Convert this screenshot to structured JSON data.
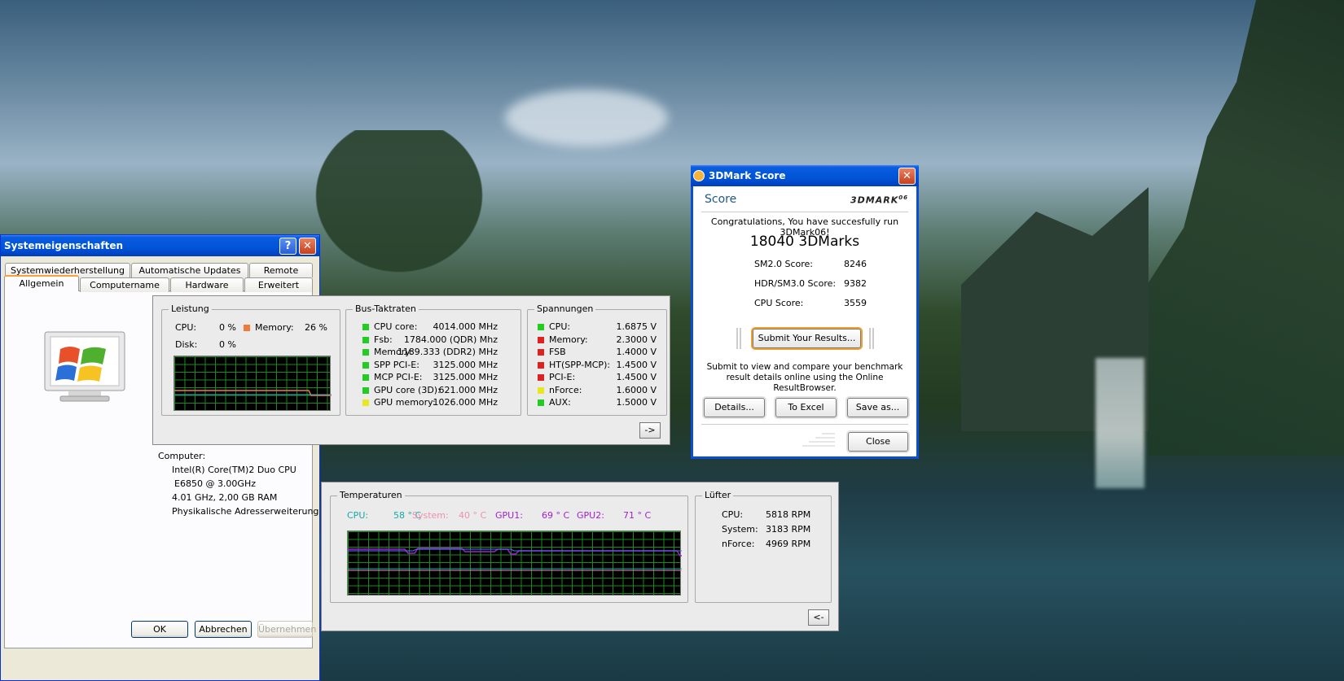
{
  "desktop": {
    "wallpaper": "tropical-island"
  },
  "sysprops": {
    "title": "Systemeigenschaften",
    "tabs_row1": [
      "Systemwiederherstellung",
      "Automatische Updates",
      "Remote"
    ],
    "tabs_row2": [
      "Allgemein",
      "Computername",
      "Hardware",
      "Erweitert"
    ],
    "computer_label": "Computer:",
    "computer_lines": [
      "Intel(R) Core(TM)2 Duo CPU",
      "E6850  @ 3.00GHz",
      "4.01 GHz, 2,00 GB RAM",
      "Physikalische Adresserweiterung"
    ],
    "buttons": {
      "ok": "OK",
      "cancel": "Abbrechen",
      "apply": "Übernehmen"
    }
  },
  "monitor_top": {
    "leistung": {
      "title": "Leistung",
      "cpu_label": "CPU:",
      "cpu_value": "0 %",
      "memory_label": "Memory:",
      "memory_value": "26 %",
      "disk_label": "Disk:",
      "disk_value": "0 %"
    },
    "bus": {
      "title": "Bus-Taktraten",
      "rows": [
        {
          "label": "CPU core:",
          "value": "4014.000 MHz",
          "color": "#22cc22"
        },
        {
          "label": "Fsb:",
          "value": "1784.000 (QDR) Mhz",
          "color": "#22cc22"
        },
        {
          "label": "Memory:",
          "value": "1189.333 (DDR2) MHz",
          "color": "#22cc22"
        },
        {
          "label": "SPP PCI-E:",
          "value": "3125.000 MHz",
          "color": "#22cc22"
        },
        {
          "label": "MCP PCI-E:",
          "value": "3125.000 MHz",
          "color": "#22cc22"
        },
        {
          "label": "GPU core (3D):",
          "value": "621.000 MHz",
          "color": "#22cc22"
        },
        {
          "label": "GPU memory:",
          "value": "1026.000 MHz",
          "color": "#e8e822"
        }
      ]
    },
    "volt": {
      "title": "Spannungen",
      "rows": [
        {
          "label": "CPU:",
          "value": "1.6875 V",
          "color": "#22cc22"
        },
        {
          "label": "Memory:",
          "value": "2.3000 V",
          "color": "#dd2222"
        },
        {
          "label": "FSB",
          "value": "1.4000 V",
          "color": "#dd2222"
        },
        {
          "label": "HT(SPP-MCP):",
          "value": "1.4500 V",
          "color": "#dd2222"
        },
        {
          "label": "PCI-E:",
          "value": "1.4500 V",
          "color": "#dd2222"
        },
        {
          "label": "nForce:",
          "value": "1.6000 V",
          "color": "#e8e822"
        },
        {
          "label": "AUX:",
          "value": "1.5000 V",
          "color": "#22cc22"
        }
      ]
    },
    "arrow": "->"
  },
  "monitor_bottom": {
    "temps": {
      "title": "Temperaturen",
      "items": [
        {
          "label": "CPU:",
          "value": "58 ° C",
          "color": "#17a8a8"
        },
        {
          "label": "System:",
          "value": "40 ° C",
          "color": "#ee8fb3"
        },
        {
          "label": "GPU1:",
          "value": "69 ° C",
          "color": "#a21fcf"
        },
        {
          "label": "GPU2:",
          "value": "71 ° C",
          "color": "#a21fcf"
        }
      ]
    },
    "fans": {
      "title": "Lüfter",
      "rows": [
        {
          "label": "CPU:",
          "value": "5818 RPM"
        },
        {
          "label": "System:",
          "value": "3183 RPM"
        },
        {
          "label": "nForce:",
          "value": "4969 RPM"
        }
      ]
    },
    "arrow": "<-"
  },
  "mark": {
    "title": "3DMark Score",
    "score_heading": "Score",
    "logo": "3DMARK",
    "logo_sup": "06",
    "congrats": "Congratulations, You have succesfully run 3DMark06!",
    "total": "18040 3DMarks",
    "scores": [
      {
        "label": "SM2.0 Score:",
        "value": "8246"
      },
      {
        "label": "HDR/SM3.0 Score:",
        "value": "9382"
      },
      {
        "label": "CPU Score:",
        "value": "3559"
      }
    ],
    "submit": "Submit Your Results...",
    "submit_text": "Submit to view and compare your benchmark result details online using the Online ResultBrowser.",
    "details": "Details...",
    "excel": "To Excel",
    "save": "Save as...",
    "close": "Close"
  }
}
